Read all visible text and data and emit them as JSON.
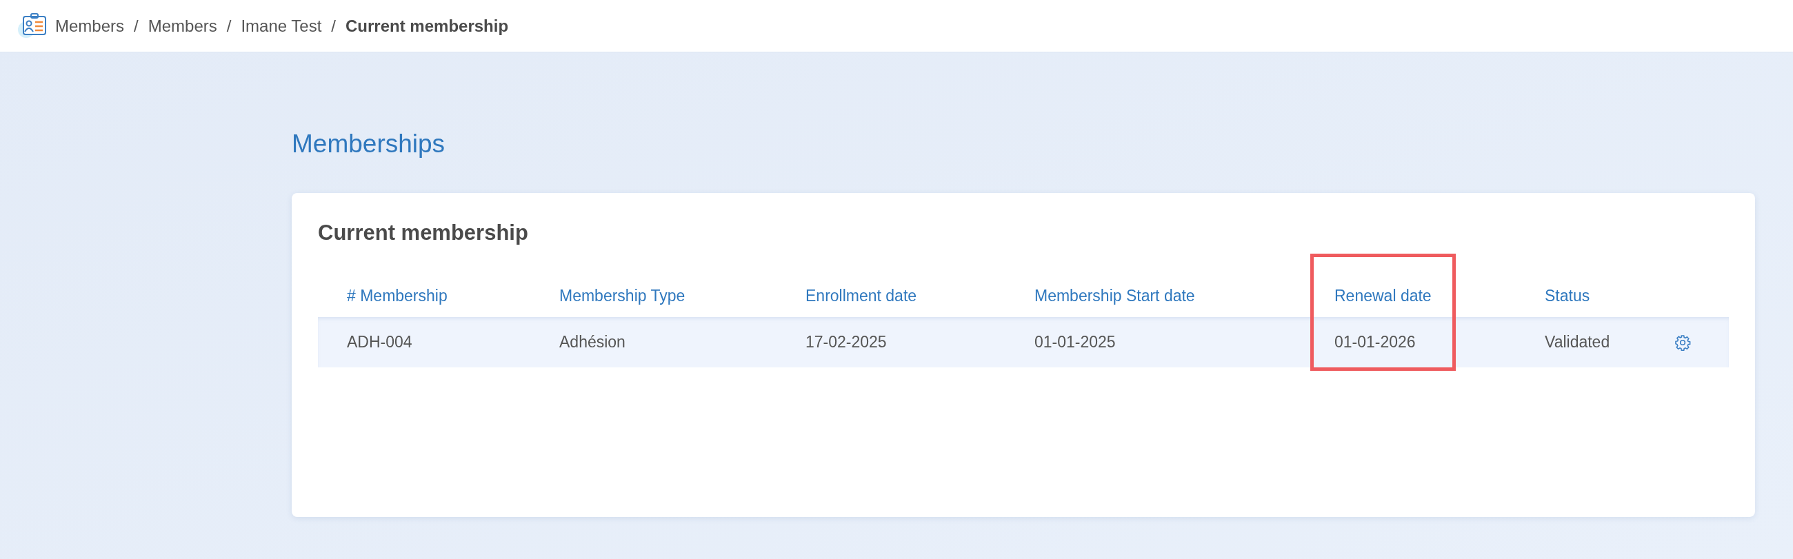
{
  "breadcrumb": [
    {
      "label": "Members",
      "current": false
    },
    {
      "label": "Members",
      "current": false
    },
    {
      "label": "Imane Test",
      "current": false
    },
    {
      "label": "Current membership",
      "current": true
    }
  ],
  "breadcrumb_separator": "/",
  "page_title": "Memberships",
  "card": {
    "title": "Current membership",
    "table": {
      "columns": [
        {
          "label": "# Membership",
          "highlighted": false
        },
        {
          "label": "Membership Type",
          "highlighted": false
        },
        {
          "label": "Enrollment date",
          "highlighted": false
        },
        {
          "label": "Membership Start date",
          "highlighted": false
        },
        {
          "label": "Renewal date",
          "highlighted": true
        },
        {
          "label": "Status",
          "highlighted": false
        }
      ],
      "rows": [
        {
          "cells": [
            "ADH-004",
            "Adhésion",
            "17-02-2025",
            "01-01-2025",
            "01-01-2026",
            "Validated"
          ]
        }
      ]
    }
  }
}
